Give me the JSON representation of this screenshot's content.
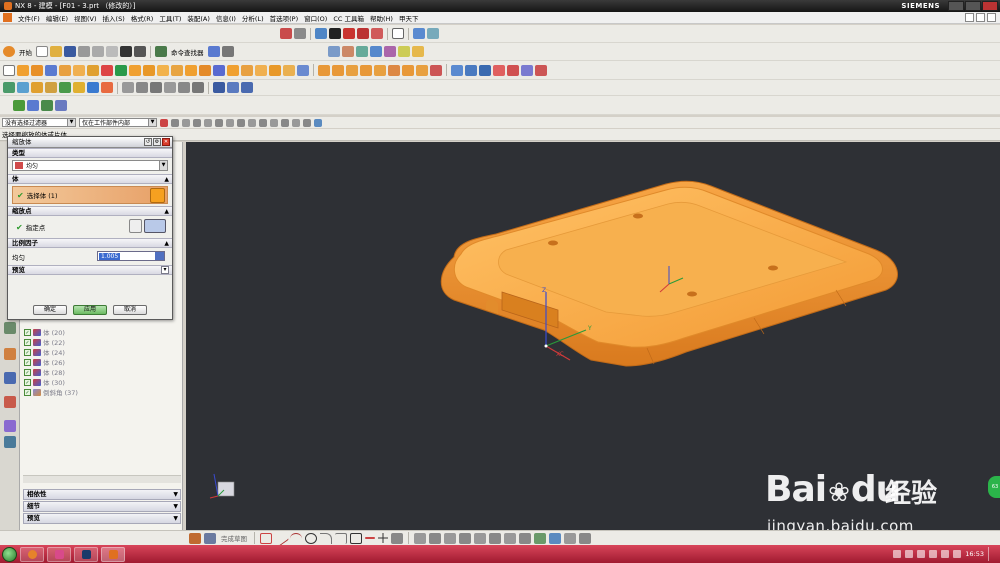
{
  "window": {
    "title": "NX 8 - 建模 - [F01 - 3.prt （修改的）]",
    "brand": "SIEMENS"
  },
  "menu": [
    "文件(F)",
    "编辑(E)",
    "视图(V)",
    "插入(S)",
    "格式(R)",
    "工具(T)",
    "装配(A)",
    "信息(I)",
    "分析(L)",
    "首选项(P)",
    "窗口(O)",
    "CC 工具箱",
    "帮助(H)",
    "甲天下"
  ],
  "toolbar": {
    "start_label": "开始",
    "command_finder": "命令查找器"
  },
  "filters": {
    "type_filter": "没有选择过滤器",
    "scope_filter": "仅在工作部件内部"
  },
  "cue": "选择要缩放的体或片体",
  "dialog": {
    "title": "缩放体",
    "type_section": "类型",
    "type_value": "均匀",
    "body_section": "体",
    "select_body": "选择体 (1)",
    "point_section": "缩放点",
    "specify_point": "指定点",
    "factor_section": "比例因子",
    "uniform_label": "均匀",
    "uniform_value": "1.005",
    "preview_section": "预览",
    "ok": "确定",
    "apply": "应用",
    "cancel": "取消"
  },
  "navigator": {
    "rows": [
      {
        "label": "体 (20)"
      },
      {
        "label": "体 (22)"
      },
      {
        "label": "体 (24)"
      },
      {
        "label": "体 (26)"
      },
      {
        "label": "体 (28)"
      },
      {
        "label": "体 (30)"
      },
      {
        "label": "倒斜角 (37)"
      }
    ],
    "panels": [
      "相依性",
      "细节",
      "预览"
    ]
  },
  "sketch": {
    "label": "完成草图"
  },
  "clock": "16:53",
  "watermark": {
    "word": "Bai",
    "word2": "du",
    "cn": "经验",
    "url": "jingyan.baidu.com"
  },
  "side_badge": "63",
  "colors": {
    "viewport": "#2e3035",
    "part": "#f6a640",
    "taskbar": "#c02a40",
    "selection": "#e7a067"
  }
}
